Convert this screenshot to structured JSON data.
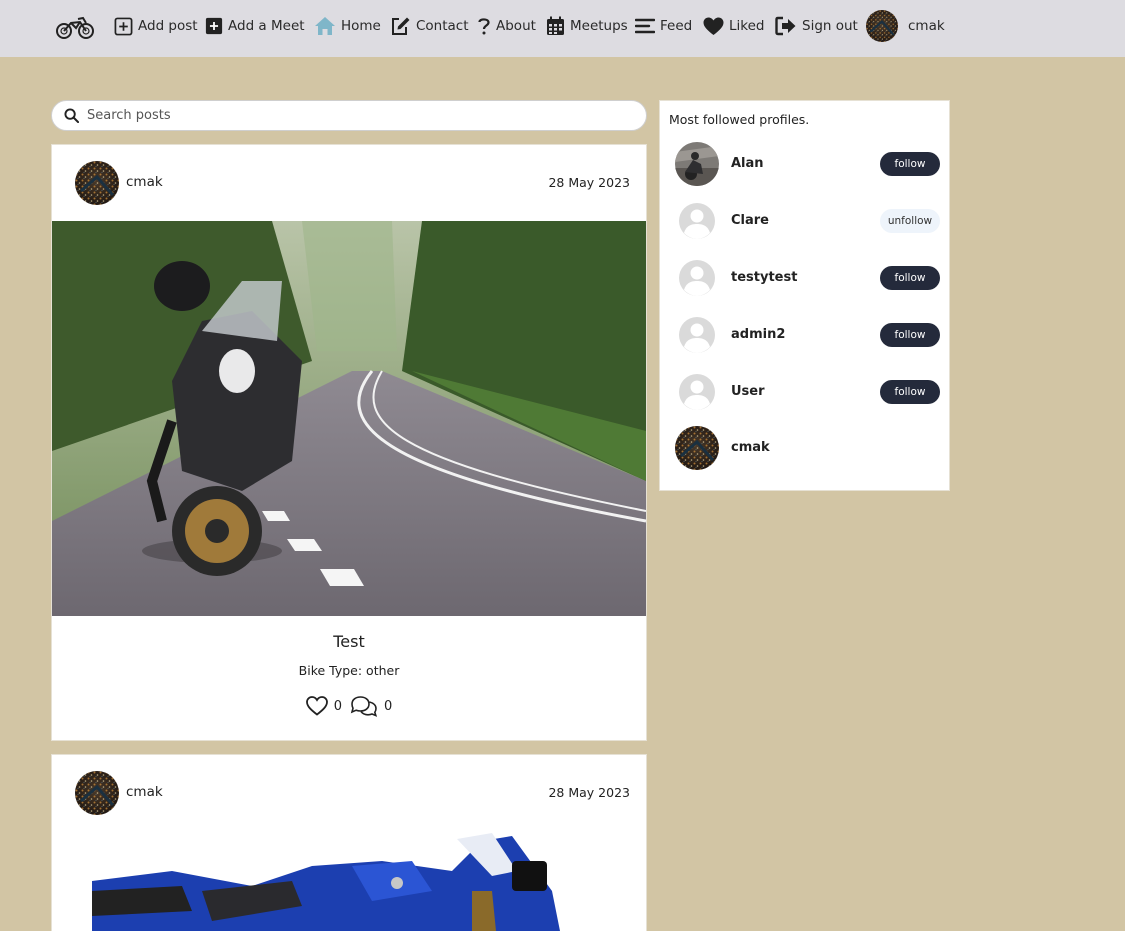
{
  "nav": {
    "add_post": "Add post",
    "add_meet": "Add a Meet",
    "home": "Home",
    "contact": "Contact",
    "about": "About",
    "meetups": "Meetups",
    "feed": "Feed",
    "liked": "Liked",
    "sign_out": "Sign out",
    "username": "cmak"
  },
  "search": {
    "placeholder": "Search posts"
  },
  "posts": [
    {
      "author": "cmak",
      "date": "28 May 2023",
      "title": "Test",
      "bike_type": "Bike Type: other",
      "likes": "0",
      "comments": "0"
    },
    {
      "author": "cmak",
      "date": "28 May 2023"
    }
  ],
  "sidebar": {
    "title": "Most followed profiles.",
    "profiles": [
      {
        "name": "Alan",
        "button": "follow"
      },
      {
        "name": "Clare",
        "button": "unfollow"
      },
      {
        "name": "testytest",
        "button": "follow"
      },
      {
        "name": "admin2",
        "button": "follow"
      },
      {
        "name": "User",
        "button": "follow"
      },
      {
        "name": "cmak"
      }
    ]
  },
  "colors": {
    "page_bg": "#d2c5a4",
    "navbar_bg": "#dddce1",
    "follow_btn": "#242a3b",
    "unfollow_btn": "#eef4fb",
    "home_icon": "#7fb6c9"
  }
}
